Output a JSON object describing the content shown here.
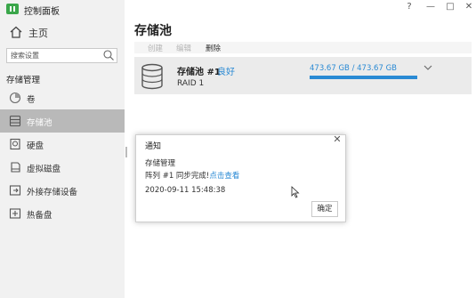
{
  "app": {
    "title": "控制面板"
  },
  "window": {
    "pin": "?",
    "minimize": "—",
    "maximize": "□",
    "close": "✕"
  },
  "sidebar": {
    "home_label": "主页",
    "search_placeholder": "搜索设置",
    "section_title": "存储管理",
    "items": [
      {
        "label": "卷",
        "icon": "volume-icon",
        "active": false
      },
      {
        "label": "存储池",
        "icon": "storage-pool-icon",
        "active": true
      },
      {
        "label": "硬盘",
        "icon": "hard-disk-icon",
        "active": false
      },
      {
        "label": "虚拟磁盘",
        "icon": "virtual-disk-icon",
        "active": false
      },
      {
        "label": "外接存储设备",
        "icon": "external-storage-icon",
        "active": false
      },
      {
        "label": "热备盘",
        "icon": "hot-spare-icon",
        "active": false
      }
    ]
  },
  "main": {
    "title": "存储池",
    "toolbar": {
      "create": "创建",
      "edit": "编辑",
      "delete": "删除"
    },
    "pool": {
      "name": "存储池 #1",
      "status": "良好",
      "raid": "RAID 1",
      "capacity": "473.67 GB / 473.67 GB",
      "usage_fraction": 1.0
    }
  },
  "dialog": {
    "title": "通知",
    "subtitle": "存储管理",
    "message": "阵列 #1 同步完成!",
    "link": "点击查看",
    "timestamp": "2020-09-11 15:48:38",
    "ok": "确定"
  },
  "colors": {
    "accent": "#2a8ad4",
    "logo": "#3aa64a",
    "active_nav": "#b9b9b9"
  }
}
